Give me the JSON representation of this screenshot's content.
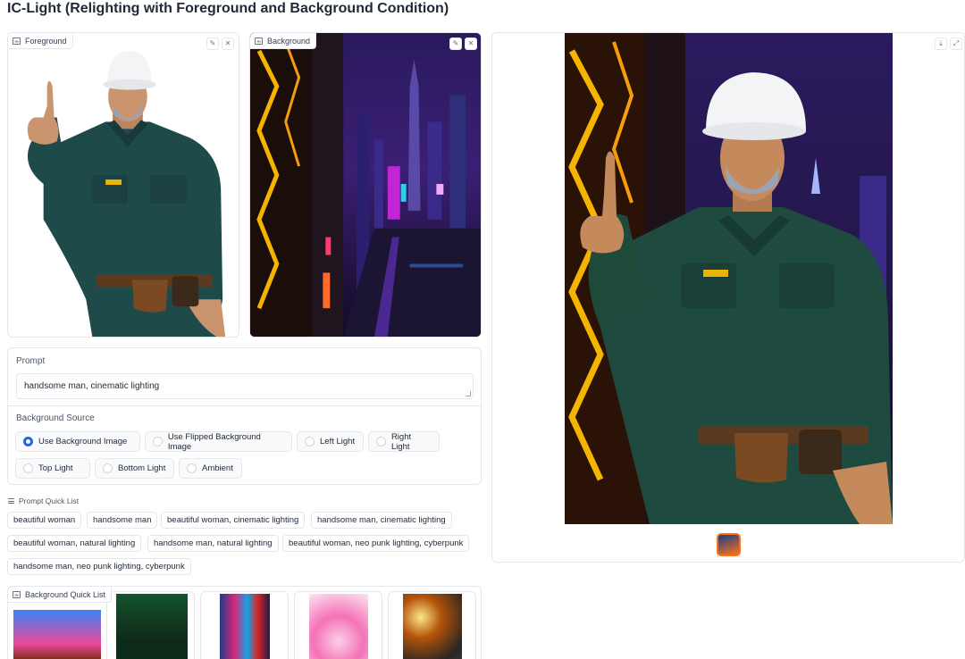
{
  "app": {
    "title": "IC-Light (Relighting with Foreground and Background Condition)"
  },
  "foreground": {
    "label": "Foreground",
    "icons": [
      "image-icon",
      "pencil-icon",
      "close-icon"
    ]
  },
  "background": {
    "label": "Background",
    "icons": [
      "image-icon",
      "pencil-icon",
      "close-icon"
    ]
  },
  "result": {
    "icons": [
      "download-icon",
      "fullscreen-icon"
    ]
  },
  "prompt": {
    "label": "Prompt",
    "value": "handsome man, cinematic lighting"
  },
  "background_source": {
    "label": "Background Source",
    "selected": "Use Background Image",
    "options": [
      "Use Background Image",
      "Use Flipped Background Image",
      "Left Light",
      "Right Light",
      "Top Light",
      "Bottom Light",
      "Ambient"
    ]
  },
  "prompt_quick_list": {
    "label": "Prompt Quick List",
    "items": [
      "beautiful woman",
      "handsome man",
      "beautiful woman, cinematic lighting",
      "handsome man, cinematic lighting",
      "beautiful woman, natural lighting",
      "handsome man, natural lighting",
      "beautiful woman, neo punk lighting, cyberpunk",
      "handsome man, neo punk lighting, cyberpunk"
    ]
  },
  "background_quick_list": {
    "label": "Background Quick List"
  },
  "colors": {
    "accent": "#2563eb",
    "selected_thumb_border": "#f97316",
    "border": "#e5e7eb"
  }
}
